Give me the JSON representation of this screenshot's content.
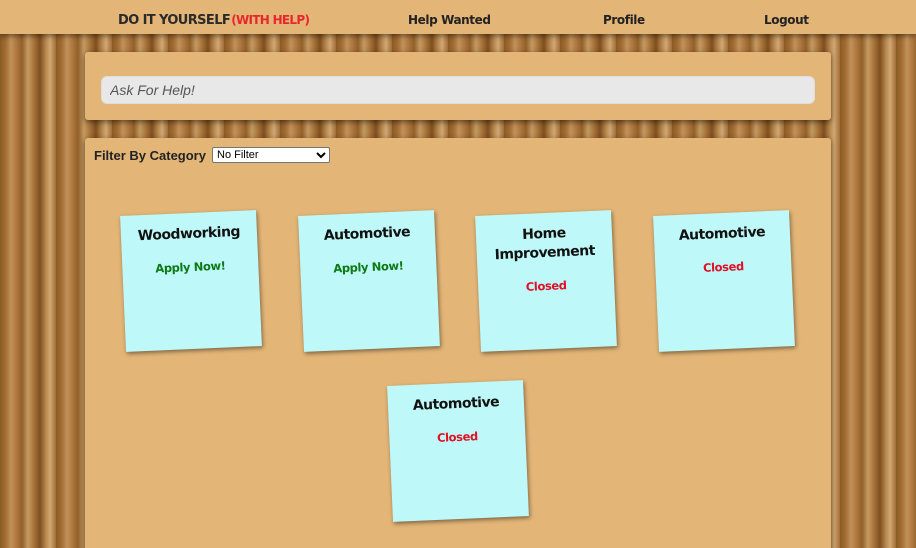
{
  "nav": {
    "logo_main": "DO IT YOURSELF",
    "logo_sub": "(WITH HELP)",
    "links": [
      "Help Wanted",
      "Profile",
      "Logout"
    ]
  },
  "ask": {
    "placeholder": "Ask For Help!"
  },
  "filter": {
    "label": "Filter By Category",
    "selected": "No Filter"
  },
  "requests": [
    {
      "category": "Woodworking",
      "status": "Apply Now!"
    },
    {
      "category": "Automotive",
      "status": "Apply Now!"
    },
    {
      "category": "Home Improvement",
      "status": "Closed"
    },
    {
      "category": "Automotive",
      "status": "Closed"
    },
    {
      "category": "Automotive",
      "status": "Closed"
    }
  ],
  "colors": {
    "note": "#bff8f8",
    "open": "#0d7a17",
    "closed": "#e01025",
    "panel": "#e3b577",
    "logo_accent": "#e8272d"
  }
}
